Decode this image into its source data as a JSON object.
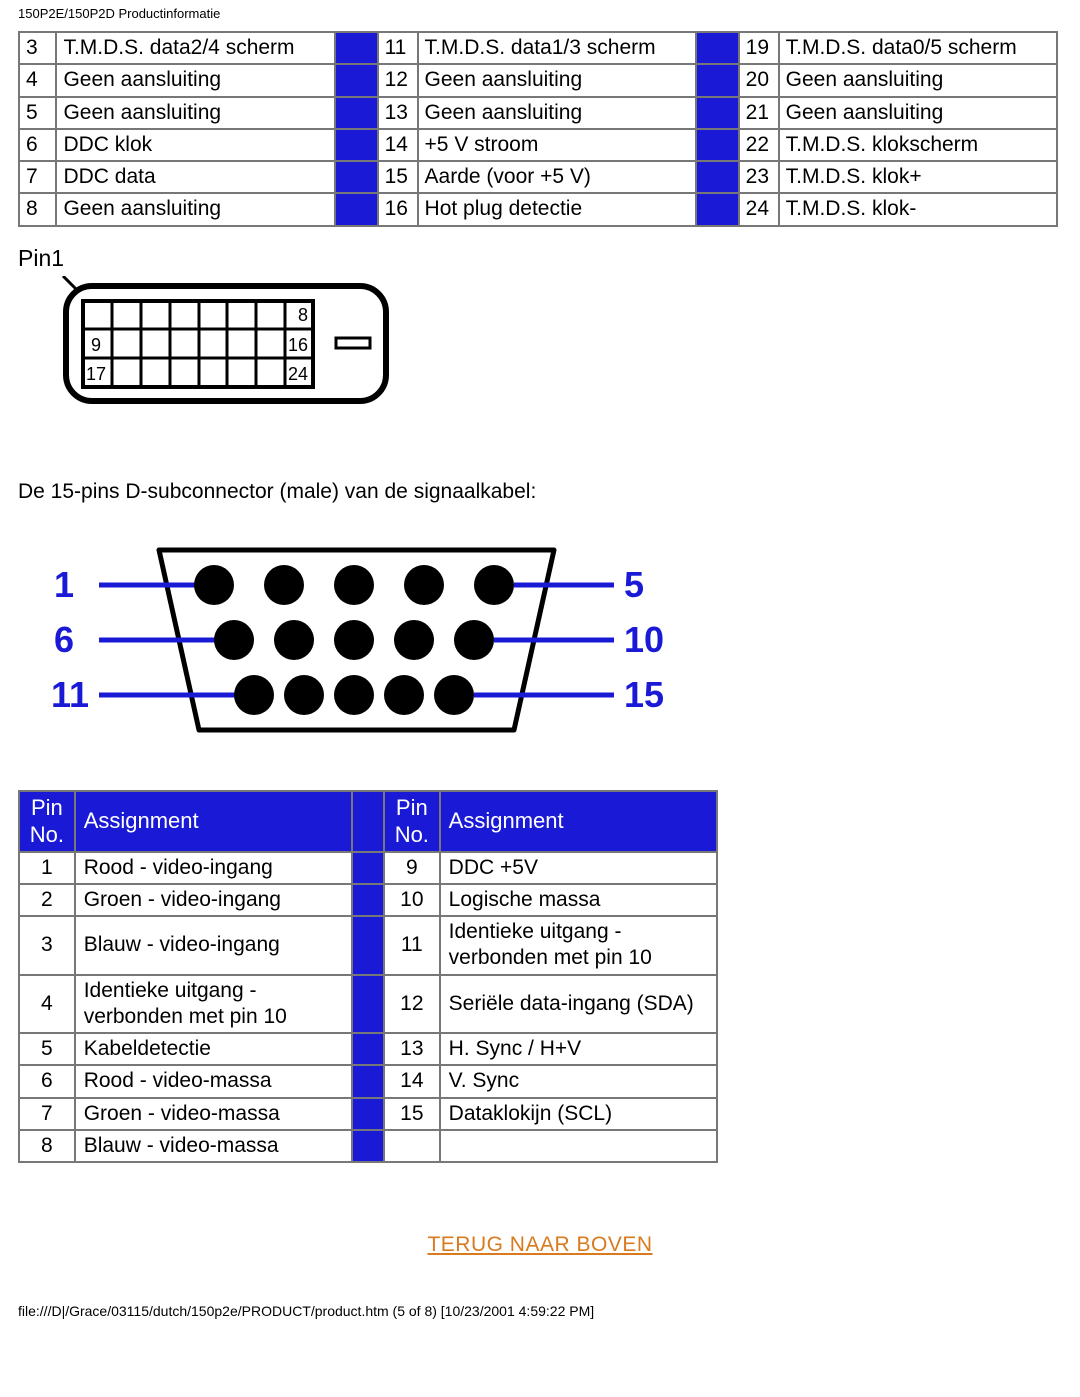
{
  "header": "150P2E/150P2D Productinformatie",
  "tmds": {
    "rows": [
      {
        "c1p": "3",
        "c1d": "T.M.D.S. data2/4 scherm",
        "c2p": "11",
        "c2d": "T.M.D.S. data1/3 scherm",
        "c3p": "19",
        "c3d": "T.M.D.S. data0/5 scherm"
      },
      {
        "c1p": "4",
        "c1d": "Geen aansluiting",
        "c2p": "12",
        "c2d": "Geen aansluiting",
        "c3p": "20",
        "c3d": "Geen aansluiting"
      },
      {
        "c1p": "5",
        "c1d": "Geen aansluiting",
        "c2p": "13",
        "c2d": "Geen aansluiting",
        "c3p": "21",
        "c3d": "Geen aansluiting"
      },
      {
        "c1p": "6",
        "c1d": "DDC klok",
        "c2p": "14",
        "c2d": "+5 V stroom",
        "c3p": "22",
        "c3d": "T.M.D.S. klokscherm"
      },
      {
        "c1p": "7",
        "c1d": "DDC data",
        "c2p": "15",
        "c2d": "Aarde (voor +5 V)",
        "c3p": "23",
        "c3d": "T.M.D.S. klok+"
      },
      {
        "c1p": "8",
        "c1d": "Geen aansluiting",
        "c2p": "16",
        "c2d": "Hot plug detectie",
        "c3p": "24",
        "c3d": "T.M.D.S. klok-"
      }
    ]
  },
  "pin1_label": "Pin1",
  "dvi_labels": {
    "r1": "8",
    "r2a": "9",
    "r2b": "16",
    "r3a": "17",
    "r3b": "24"
  },
  "caption": "De 15-pins D-subconnector (male) van de signaalkabel:",
  "dsub_labels": {
    "l1": "1",
    "l2": "6",
    "l3": "11",
    "r1": "5",
    "r2": "10",
    "r3": "15"
  },
  "assign": {
    "headers": {
      "pin": "Pin No.",
      "assign": "Assignment"
    },
    "left": [
      {
        "p": "1",
        "d": "Rood - video-ingang"
      },
      {
        "p": "2",
        "d": "Groen - video-ingang"
      },
      {
        "p": "3",
        "d": "Blauw - video-ingang"
      },
      {
        "p": "4",
        "d": "Identieke uitgang - verbonden met pin 10"
      },
      {
        "p": "5",
        "d": "Kabeldetectie"
      },
      {
        "p": "6",
        "d": "Rood - video-massa"
      },
      {
        "p": "7",
        "d": "Groen - video-massa"
      },
      {
        "p": "8",
        "d": "Blauw - video-massa"
      }
    ],
    "right": [
      {
        "p": "9",
        "d": "DDC +5V"
      },
      {
        "p": "10",
        "d": "Logische massa"
      },
      {
        "p": "11",
        "d": "Identieke uitgang - verbonden met pin 10"
      },
      {
        "p": "12",
        "d": "Seriële data-ingang (SDA)"
      },
      {
        "p": "13",
        "d": "H. Sync / H+V"
      },
      {
        "p": "14",
        "d": "V. Sync"
      },
      {
        "p": "15",
        "d": "Dataklokijn (SCL)"
      },
      {
        "p": "",
        "d": ""
      }
    ]
  },
  "toplink": "TERUG NAAR BOVEN",
  "footer": "file:///D|/Grace/03115/dutch/150p2e/PRODUCT/product.htm (5 of 8) [10/23/2001 4:59:22 PM]"
}
